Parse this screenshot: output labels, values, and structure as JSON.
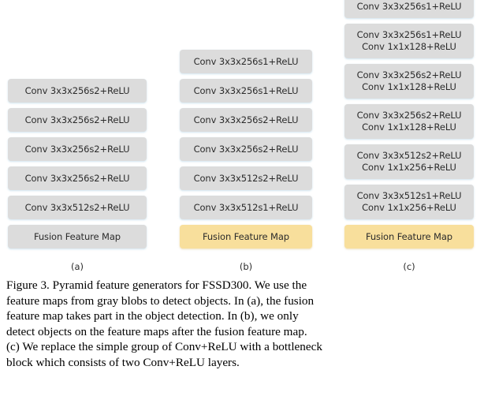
{
  "figure": {
    "columns": [
      {
        "id": "a",
        "label": "(a)",
        "blocks": [
          {
            "lines": [
              "Conv 3x3x256s2+ReLU"
            ],
            "kind": "conv"
          },
          {
            "lines": [
              "Conv 3x3x256s2+ReLU"
            ],
            "kind": "conv"
          },
          {
            "lines": [
              "Conv 3x3x256s2+ReLU"
            ],
            "kind": "conv"
          },
          {
            "lines": [
              "Conv 3x3x256s2+ReLU"
            ],
            "kind": "conv"
          },
          {
            "lines": [
              "Conv 3x3x512s2+ReLU"
            ],
            "kind": "conv"
          },
          {
            "lines": [
              "Fusion Feature Map"
            ],
            "kind": "fusion-gray"
          }
        ]
      },
      {
        "id": "b",
        "label": "(b)",
        "blocks": [
          {
            "lines": [
              "Conv 3x3x256s1+ReLU"
            ],
            "kind": "conv"
          },
          {
            "lines": [
              "Conv 3x3x256s1+ReLU"
            ],
            "kind": "conv"
          },
          {
            "lines": [
              "Conv 3x3x256s2+ReLU"
            ],
            "kind": "conv"
          },
          {
            "lines": [
              "Conv 3x3x256s2+ReLU"
            ],
            "kind": "conv"
          },
          {
            "lines": [
              "Conv 3x3x512s2+ReLU"
            ],
            "kind": "conv"
          },
          {
            "lines": [
              "Conv 3x3x512s1+ReLU"
            ],
            "kind": "conv"
          },
          {
            "lines": [
              "Fusion Feature Map"
            ],
            "kind": "fusion-yellow"
          }
        ]
      },
      {
        "id": "c",
        "label": "(c)",
        "blocks": [
          {
            "lines": [
              "Conv 3x3x256s1+ReLU"
            ],
            "kind": "conv"
          },
          {
            "lines": [
              "Conv 3x3x256s1+ReLU",
              "Conv 1x1x128+ReLU"
            ],
            "kind": "conv"
          },
          {
            "lines": [
              "Conv 3x3x256s2+ReLU",
              "Conv 1x1x128+ReLU"
            ],
            "kind": "conv"
          },
          {
            "lines": [
              "Conv 3x3x256s2+ReLU",
              "Conv 1x1x128+ReLU"
            ],
            "kind": "conv"
          },
          {
            "lines": [
              "Conv 3x3x512s2+ReLU",
              "Conv 1x1x256+ReLU"
            ],
            "kind": "conv"
          },
          {
            "lines": [
              "Conv 3x3x512s1+ReLU",
              "Conv 1x1x256+ReLU"
            ],
            "kind": "conv"
          },
          {
            "lines": [
              "Fusion Feature Map"
            ],
            "kind": "fusion-yellow"
          }
        ]
      }
    ],
    "colors": {
      "conv_block": "#dcdcdc",
      "fusion_block": "#f8df9c",
      "text": "#2b2b2b",
      "background": "#ffffff"
    }
  },
  "caption": {
    "full_text": "Figure 3. Pyramid feature generators for FSSD300. We use the feature maps from gray blobs to detect objects. In (a), the fusion feature map takes part in the object detection. In (b), we only detect objects on the feature maps after the fusion feature map. (c) We replace the simple group of Conv+ReLU with a bottleneck block which consists of two Conv+ReLU layers.",
    "lines": [
      "Figure 3. Pyramid feature generators for FSSD300.  We use the",
      "feature maps from gray blobs to detect objects. In (a), the fusion",
      "feature map takes part in the object detection.  In (b), we only",
      "detect objects on the feature maps after the fusion feature map.",
      "(c) We replace the simple group of Conv+ReLU with a bottleneck",
      "block which consists of two Conv+ReLU layers."
    ]
  }
}
